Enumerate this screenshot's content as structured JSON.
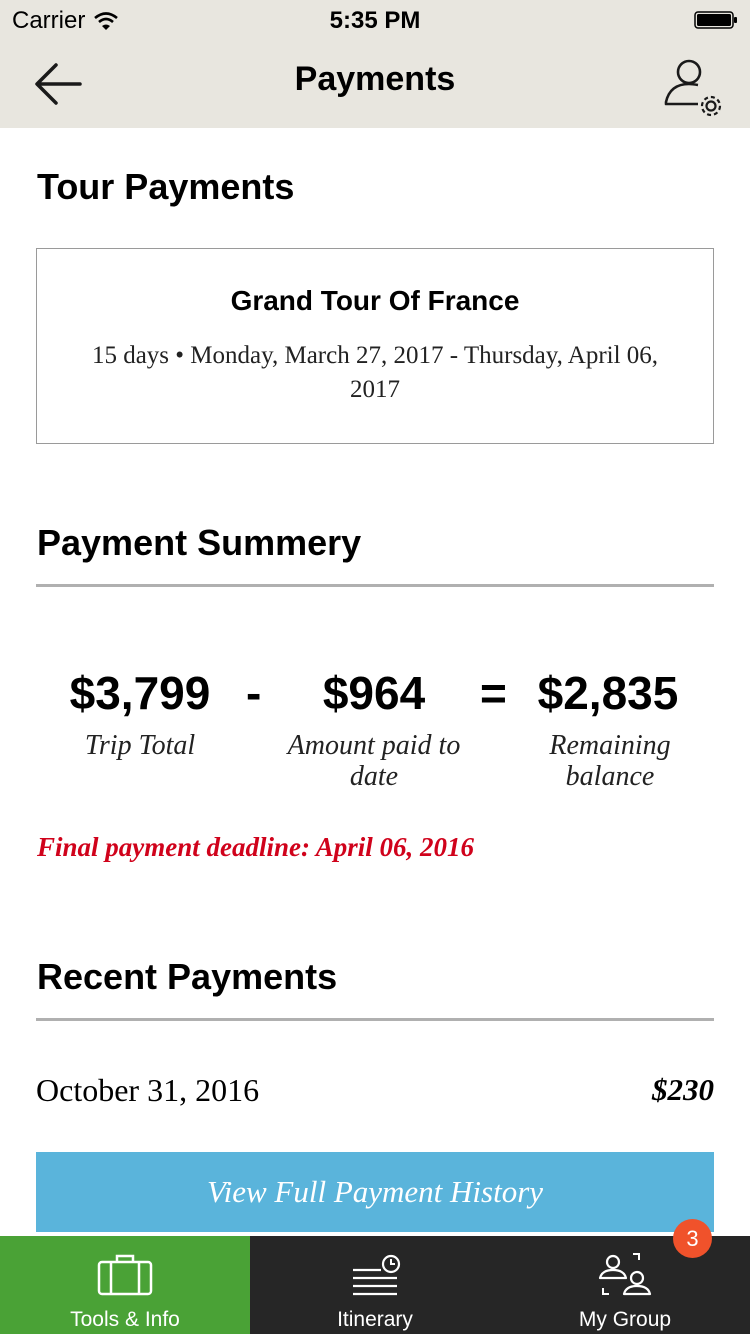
{
  "status_bar": {
    "carrier": "Carrier",
    "time": "5:35 PM"
  },
  "nav": {
    "title": "Payments"
  },
  "tour_payments": {
    "heading": "Tour Payments",
    "tour_name": "Grand Tour Of France",
    "tour_dates": "15 days • Monday, March 27, 2017 - Thursday, April 06, 2017"
  },
  "summary": {
    "heading": "Payment Summery",
    "trip_total": "$3,799",
    "trip_total_label": "Trip Total",
    "minus": "-",
    "paid": "$964",
    "paid_label": "Amount paid to date",
    "equals": "=",
    "remaining": "$2,835",
    "remaining_label": "Remaining balance",
    "deadline": "Final payment deadline: April 06, 2016",
    "deadline_color": "#d0021b"
  },
  "recent": {
    "heading": "Recent Payments",
    "payments": [
      {
        "date": "October 31, 2016",
        "amount": "$230"
      }
    ],
    "history_button": "View Full Payment History"
  },
  "tabs": [
    {
      "label": "Tools & Info",
      "icon": "suitcase-icon",
      "active": true
    },
    {
      "label": "Itinerary",
      "icon": "itinerary-clock-icon",
      "active": false
    },
    {
      "label": "My Group",
      "icon": "group-icon",
      "active": false,
      "badge": "3"
    }
  ],
  "colors": {
    "bar_bg": "#e8e6df",
    "accent_green": "#4aa236",
    "button_blue": "#5ab4db",
    "badge_orange": "#f0522b",
    "tabbar_bg": "#262626"
  }
}
